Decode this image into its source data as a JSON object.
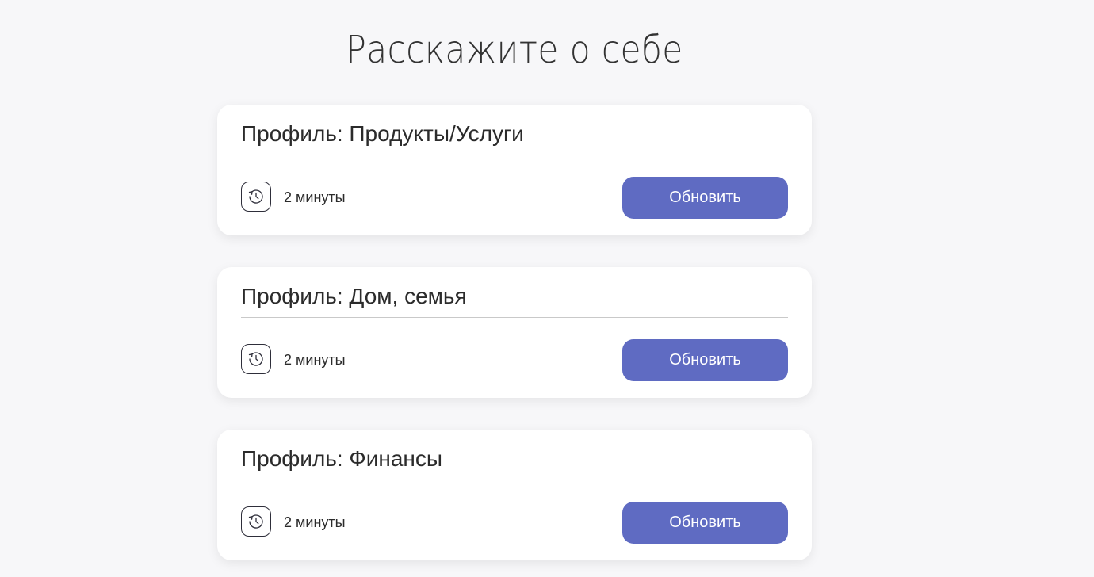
{
  "page": {
    "title": "Расскажите о себе"
  },
  "cards": [
    {
      "title": "Профиль: Продукты/Услуги",
      "time_label": "2 минуты",
      "button_label": "Обновить",
      "icon": "history-clock-icon"
    },
    {
      "title": "Профиль: Дом, семья",
      "time_label": "2 минуты",
      "button_label": "Обновить",
      "icon": "history-clock-icon"
    },
    {
      "title": "Профиль: Финансы",
      "time_label": "2 минуты",
      "button_label": "Обновить",
      "icon": "history-clock-icon"
    }
  ],
  "colors": {
    "background": "#f7f7f9",
    "card": "#ffffff",
    "accent": "#5f6bc2",
    "text": "#2b2b2b"
  }
}
